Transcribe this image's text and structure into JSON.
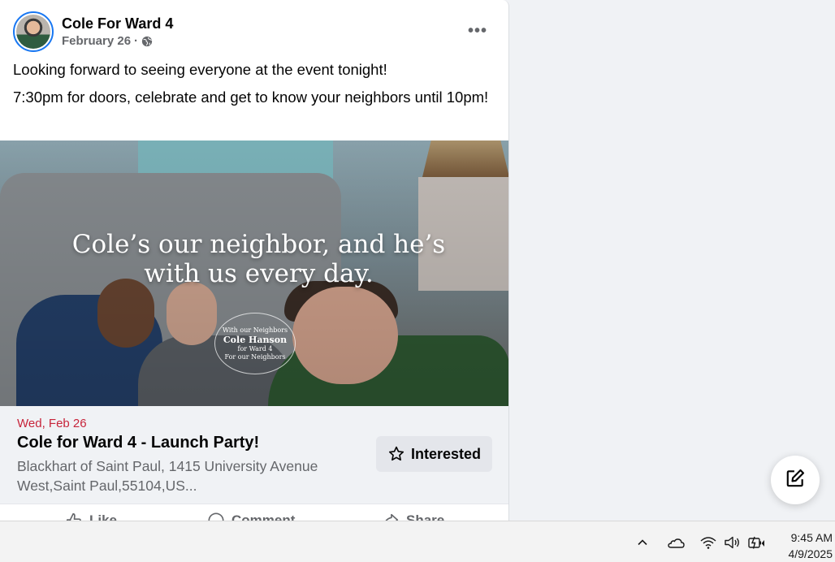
{
  "post": {
    "author": "Cole For Ward 4",
    "date": "February 26",
    "separator": "·",
    "privacy_icon": "globe-icon",
    "more_label": "•••",
    "text_line1": "Looking forward to seeing everyone at the event tonight!",
    "text_line2": "7:30pm for doors, celebrate and get to know your neighbors until 10pm!"
  },
  "image_overlay": {
    "headline_line1": "Cole’s our neighbor, and he’s",
    "headline_line2": "with us every day.",
    "seal_top": "With our Neighbors",
    "seal_name": "Cole Hanson",
    "seal_sub": "for Ward 4",
    "seal_bottom": "For our Neighbors"
  },
  "event": {
    "date": "Wed, Feb 26",
    "title": "Cole for Ward 4 - Launch Party!",
    "location": "Blackhart of Saint Paul, 1415 University Avenue West,Saint Paul,55104,US...",
    "interested_label": "Interested",
    "date_color": "#c7243a"
  },
  "actions": {
    "like": "Like",
    "comment": "Comment",
    "share": "Share"
  },
  "compose": {
    "icon": "compose-icon"
  },
  "taskbar": {
    "time": "9:45 AM",
    "date": "4/9/2025",
    "icons": [
      "chevron-up-icon",
      "onedrive-cloud-icon",
      "wifi-icon",
      "speaker-icon",
      "battery-charging-icon"
    ]
  },
  "colors": {
    "accent": "#1877f2",
    "secondary_text": "#65676b",
    "page_background": "#f0f2f5"
  }
}
